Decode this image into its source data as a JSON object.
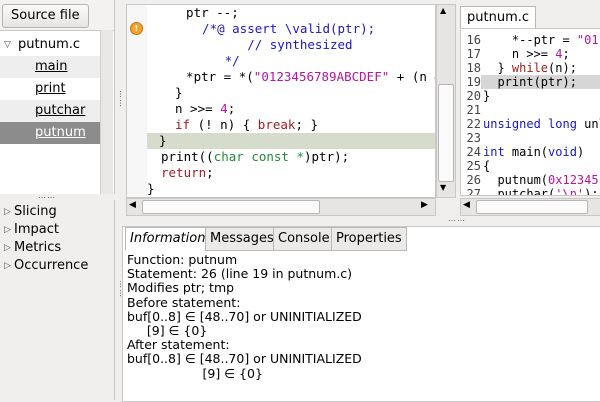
{
  "left_panel": {
    "source_file_button": "Source file",
    "file": "putnum.c",
    "functions": [
      "main",
      "print",
      "putchar",
      "putnum"
    ]
  },
  "plugins": [
    "Slicing",
    "Impact",
    "Metrics",
    "Occurrence"
  ],
  "code": {
    "lines": [
      {
        "parts": [
          {
            "t": "  ptr --;",
            "c": ""
          }
        ]
      },
      {
        "parts": [
          {
            "t": "  /*@ assert \\valid(ptr);",
            "c": "cm"
          }
        ]
      },
      {
        "parts": [
          {
            "t": "        // synthesized",
            "c": "cm"
          }
        ]
      },
      {
        "parts": [
          {
            "t": "     */",
            "c": "cm"
          }
        ]
      },
      {
        "parts": [
          {
            "t": "  *ptr = *(",
            "c": ""
          },
          {
            "t": "\"0123456789ABCDEF\"",
            "c": "str"
          },
          {
            "t": " + (n &",
            "c": ""
          }
        ]
      },
      {
        "parts": [
          {
            "t": "}",
            "c": ""
          }
        ]
      },
      {
        "parts": [
          {
            "t": "n >>= ",
            "c": ""
          },
          {
            "t": "4",
            "c": "num"
          },
          {
            "t": ";",
            "c": ""
          }
        ]
      },
      {
        "parts": [
          {
            "t": "if",
            "c": "kw"
          },
          {
            "t": " (! n) { ",
            "c": ""
          },
          {
            "t": "break",
            "c": "kw"
          },
          {
            "t": "; }",
            "c": ""
          }
        ]
      },
      {
        "parts": [
          {
            "t": "}",
            "c": ""
          }
        ]
      },
      {
        "parts": [
          {
            "t": "print((",
            "c": ""
          },
          {
            "t": "char const *",
            "c": "ty"
          },
          {
            "t": ")ptr);",
            "c": ""
          }
        ]
      },
      {
        "parts": [
          {
            "t": "return",
            "c": "kw"
          },
          {
            "t": ";",
            "c": ""
          }
        ]
      },
      {
        "parts": [
          {
            "t": "}",
            "c": ""
          }
        ]
      }
    ]
  },
  "right_panel": {
    "tab": "putnum.c",
    "lines": [
      {
        "n": "16",
        "parts": [
          {
            "t": "    *--ptr = ",
            "c": ""
          },
          {
            "t": "\"01",
            "c": "str"
          }
        ]
      },
      {
        "n": "17",
        "parts": [
          {
            "t": "    n >>= ",
            "c": ""
          },
          {
            "t": "4",
            "c": "num"
          },
          {
            "t": ";",
            "c": ""
          }
        ]
      },
      {
        "n": "18",
        "parts": [
          {
            "t": "  } ",
            "c": ""
          },
          {
            "t": "while",
            "c": "kw"
          },
          {
            "t": "(n);",
            "c": ""
          }
        ]
      },
      {
        "n": "19",
        "parts": [
          {
            "t": "  print(ptr);",
            "c": ""
          }
        ]
      },
      {
        "n": "20",
        "parts": [
          {
            "t": "}",
            "c": ""
          }
        ]
      },
      {
        "n": "21",
        "parts": [
          {
            "t": "",
            "c": ""
          }
        ]
      },
      {
        "n": "22",
        "parts": [
          {
            "t": "unsigned long ",
            "c": "cm"
          },
          {
            "t": "unl",
            "c": ""
          }
        ]
      },
      {
        "n": "23",
        "parts": [
          {
            "t": "",
            "c": ""
          }
        ]
      },
      {
        "n": "24",
        "parts": [
          {
            "t": "int",
            "c": "cm"
          },
          {
            "t": " main(",
            "c": ""
          },
          {
            "t": "void",
            "c": "cm"
          },
          {
            "t": ")",
            "c": ""
          }
        ]
      },
      {
        "n": "25",
        "parts": [
          {
            "t": "{",
            "c": ""
          }
        ]
      },
      {
        "n": "26",
        "parts": [
          {
            "t": "  putnum(",
            "c": ""
          },
          {
            "t": "0x12345",
            "c": "str"
          }
        ]
      },
      {
        "n": "27",
        "parts": [
          {
            "t": "  putchar(",
            "c": ""
          },
          {
            "t": "'\\n'",
            "c": "str"
          },
          {
            "t": ");",
            "c": ""
          }
        ]
      }
    ]
  },
  "tabs": [
    "Information",
    "Messages",
    "Console",
    "Properties"
  ],
  "info": [
    "Function: putnum",
    "Statement: 26 (line 19 in putnum.c)",
    "Modifies ptr; tmp",
    "Before statement:",
    "buf[0..8] ∈ [48..70] or UNINITIALIZED",
    "     [9] ∈ {0}",
    "After statement:",
    "buf[0..8] ∈ [48..70] or UNINITIALIZED",
    "                   [9] ∈ {0}"
  ]
}
